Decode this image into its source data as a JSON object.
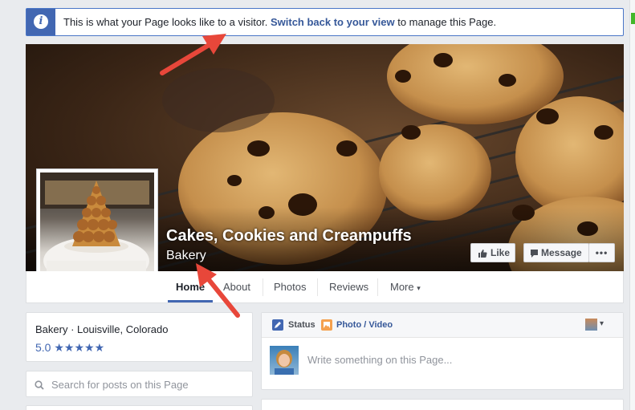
{
  "notice": {
    "text_before": "This is what your Page looks like to a visitor.",
    "link": "Switch back to your view",
    "text_after": "to manage this Page."
  },
  "page": {
    "name": "Cakes, Cookies and Creampuffs",
    "category": "Bakery"
  },
  "actions": {
    "like": "Like",
    "message": "Message",
    "more": "•••"
  },
  "tabs": [
    "Home",
    "About",
    "Photos",
    "Reviews",
    "More"
  ],
  "more_caret": "▾",
  "about": {
    "line": "Bakery · Louisville, Colorado",
    "rating": "5.0",
    "stars": "★★★★★",
    "rating_value": 5.0
  },
  "search": {
    "placeholder": "Search for posts on this Page"
  },
  "composer": {
    "status": "Status",
    "photo_video": "Photo / Video",
    "placeholder": "Write something on this Page..."
  },
  "colors": {
    "brand_blue": "#4267b2",
    "link_blue": "#365899",
    "annotation_arrow": "#e8473a"
  },
  "icons": {
    "notice": "info-icon",
    "like": "thumbs-up-icon",
    "message": "chat-bubble-icon",
    "status": "pencil-icon",
    "photo": "photo-icon",
    "search": "search-icon"
  }
}
